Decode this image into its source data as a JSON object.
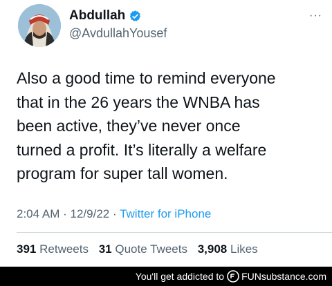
{
  "tweet": {
    "author_name": "Abdullah",
    "handle": "@AvdullahYousef",
    "text": "Also a good time to remind everyone\nthat in the 26 years the WNBA has\nbeen active, they’ve never once\nturned a profit. It’s literally a welfare\nprogram for super tall women.",
    "time": "2:04 AM",
    "date": "12/9/22",
    "separator": "·",
    "source": "Twitter for iPhone",
    "retweets_count": "391",
    "retweets_label": "Retweets",
    "quote_count": "31",
    "quote_label": "Quote Tweets",
    "likes_count": "3,908",
    "likes_label": "Likes",
    "more_glyph": "···"
  },
  "footer": {
    "message": "You'll get addicted to",
    "logo_text": "FUNsubstance.com"
  },
  "colors": {
    "accent": "#1d9bf0",
    "muted": "#536471",
    "text": "#0f1419"
  },
  "icons": {
    "verified": "verified-badge-icon",
    "more": "more-options-icon"
  }
}
